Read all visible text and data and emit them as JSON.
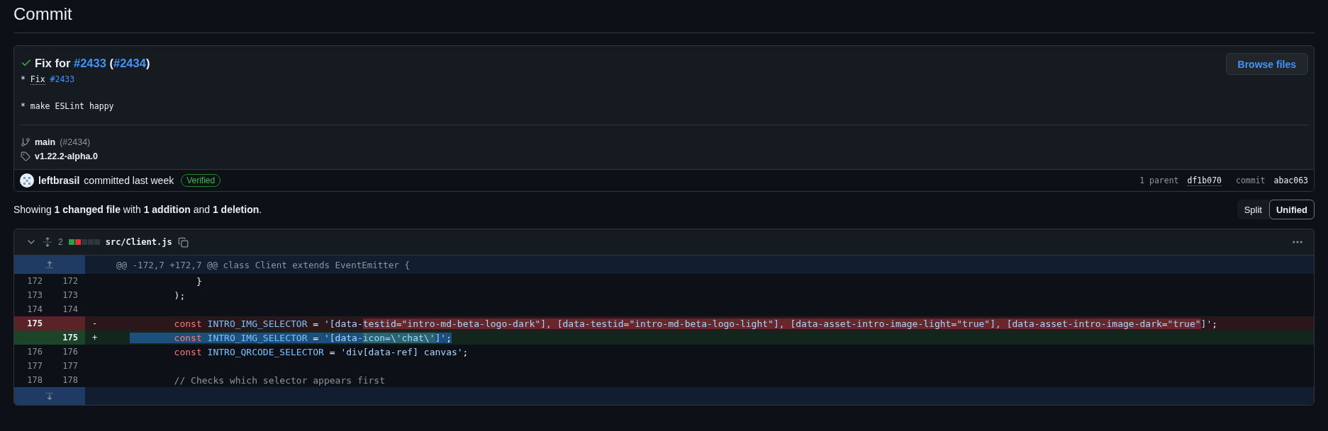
{
  "page_title": "Commit",
  "commit": {
    "verified_check": true,
    "title": [
      {
        "kind": "text",
        "text": "Fix for "
      },
      {
        "kind": "link",
        "text": "#2433"
      },
      {
        "kind": "text",
        "text": " ("
      },
      {
        "kind": "link",
        "text": "#2434"
      },
      {
        "kind": "text",
        "text": ")"
      }
    ],
    "body": [
      [
        {
          "kind": "text",
          "text": "* "
        },
        {
          "kind": "abbr",
          "text": "Fix"
        },
        {
          "kind": "link",
          "text": "#2433"
        }
      ],
      [
        {
          "kind": "text",
          "text": "* make ESLint happy"
        }
      ]
    ],
    "browse_button": "Browse files",
    "branch": {
      "name": "main",
      "ref": "(#2434)"
    },
    "tag": "v1.22.2-alpha.0",
    "author": "leftbrasil",
    "action": "committed last week",
    "badge": "Verified",
    "parent_label": "1 parent",
    "parent_sha": "df1b070",
    "commit_label": "commit",
    "commit_sha": "abac063"
  },
  "summary": "Showing **1 changed file** with **1 addition** and **1 deletion**.",
  "view_toggle": [
    {
      "label": "Split",
      "selected": false
    },
    {
      "label": "Unified",
      "selected": true
    }
  ],
  "file": {
    "expanded": true,
    "changes": "2",
    "diffstat": [
      {
        "kind": "added"
      },
      {
        "kind": "deleted"
      },
      {
        "kind": "neutral"
      },
      {
        "kind": "neutral"
      },
      {
        "kind": "neutral"
      }
    ],
    "path": "src/Client.js",
    "rows": [
      {
        "kind": "hunk",
        "expander": {
          "kind": "up"
        },
        "text": "@@ -172,7 +172,7 @@ class Client extends EventEmitter {"
      },
      {
        "kind": "context",
        "old": "172",
        "new": "172",
        "selected": false,
        "tokens": [
          {
            "kind": "plain",
            "text": "            }"
          }
        ]
      },
      {
        "kind": "context",
        "old": "173",
        "new": "173",
        "selected": false,
        "tokens": [
          {
            "kind": "plain",
            "text": "        );"
          }
        ]
      },
      {
        "kind": "context",
        "old": "174",
        "new": "174",
        "selected": false
      },
      {
        "kind": "deletion",
        "old": "175",
        "sign": "-",
        "selected": false,
        "tokens": [
          {
            "kind": "keyword",
            "text": "        const"
          },
          {
            "kind": "constant",
            "text": " INTRO_IMG_SELECTOR"
          },
          {
            "kind": "plain",
            "text": " = "
          },
          {
            "kind": "string",
            "text": "'[data-"
          },
          {
            "kind": "string",
            "hl": true,
            "text": "testid=\"intro-md-beta-logo-dark\"], [data-testid=\"intro-md-beta-logo-light\"], [data-asset-intro-image-light=\"true\"], [data-asset-intro-image-dark=\"true\""
          },
          {
            "kind": "string",
            "text": "]'"
          },
          {
            "kind": "plain",
            "text": ";"
          }
        ]
      },
      {
        "kind": "addition",
        "new": "175",
        "sign": "+",
        "selected": true,
        "tokens": [
          {
            "kind": "keyword",
            "text": "        const"
          },
          {
            "kind": "constant",
            "text": " INTRO_IMG_SELECTOR"
          },
          {
            "kind": "plain",
            "text": " = "
          },
          {
            "kind": "string",
            "text": "'[data-"
          },
          {
            "kind": "string",
            "hl": true,
            "text": "icon=\\'chat\\'"
          },
          {
            "kind": "string",
            "text": "]'"
          },
          {
            "kind": "plain",
            "text": ";"
          }
        ]
      },
      {
        "kind": "context",
        "old": "176",
        "new": "176",
        "selected": false,
        "tokens": [
          {
            "kind": "keyword",
            "text": "        const"
          },
          {
            "kind": "constant",
            "text": " INTRO_QRCODE_SELECTOR"
          },
          {
            "kind": "plain",
            "text": " = "
          },
          {
            "kind": "string",
            "text": "'div[data-ref] canvas'"
          },
          {
            "kind": "plain",
            "text": ";"
          }
        ]
      },
      {
        "kind": "context",
        "old": "177",
        "new": "177",
        "selected": false
      },
      {
        "kind": "context",
        "old": "178",
        "new": "178",
        "selected": false,
        "tokens": [
          {
            "kind": "comment",
            "text": "        // Checks which selector appears first"
          }
        ]
      },
      {
        "kind": "hunk",
        "expander": {
          "kind": "down"
        }
      }
    ]
  }
}
